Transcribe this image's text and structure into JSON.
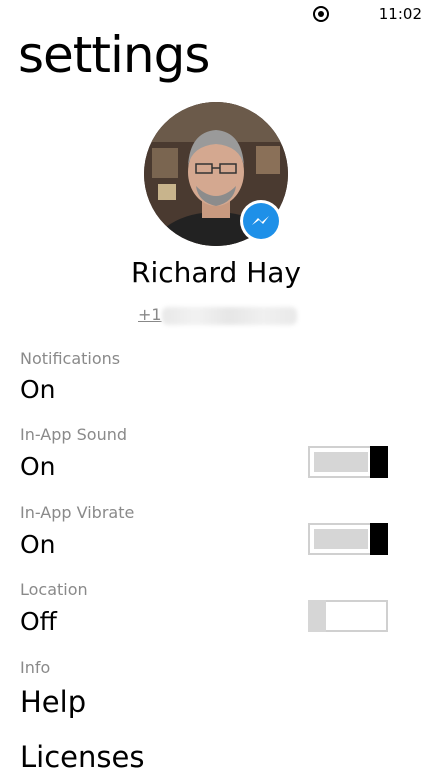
{
  "status_bar": {
    "time": "11:02",
    "record_icon": "record-icon"
  },
  "page": {
    "title": "settings"
  },
  "profile": {
    "name": "Richard Hay",
    "phone_prefix": "+1",
    "badge_icon": "messenger-icon",
    "badge_color": "#1e90e8"
  },
  "settings": {
    "notifications": {
      "label": "Notifications",
      "value": "On"
    },
    "in_app_sound": {
      "label": "In-App Sound",
      "value": "On",
      "enabled": true
    },
    "in_app_vibrate": {
      "label": "In-App Vibrate",
      "value": "On",
      "enabled": true
    },
    "location": {
      "label": "Location",
      "value": "Off",
      "enabled": false
    }
  },
  "info": {
    "label": "Info",
    "help": "Help",
    "licenses": "Licenses"
  }
}
